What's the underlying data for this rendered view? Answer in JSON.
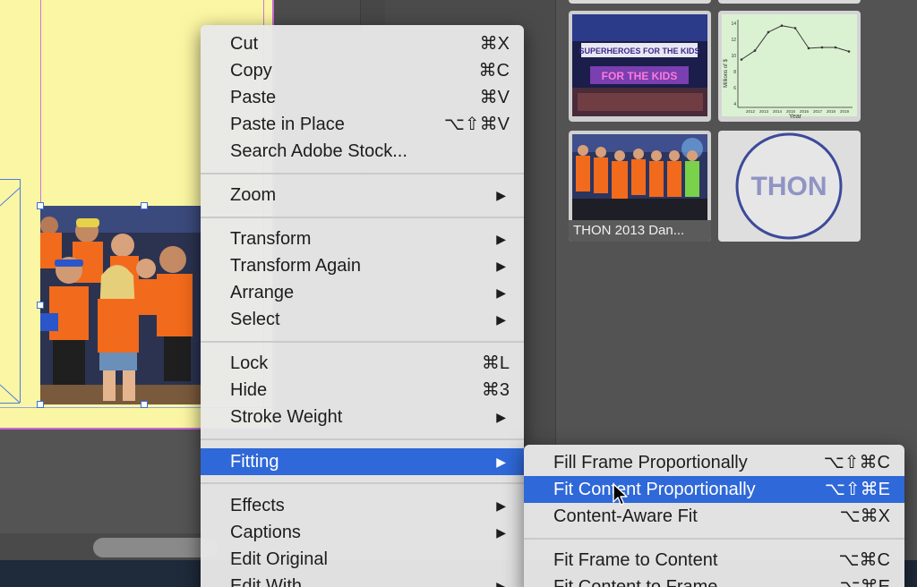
{
  "context_menu": {
    "items": [
      {
        "label": "Cut",
        "shortcut": "⌘X"
      },
      {
        "label": "Copy",
        "shortcut": "⌘C"
      },
      {
        "label": "Paste",
        "shortcut": "⌘V"
      },
      {
        "label": "Paste in Place",
        "shortcut": "⌥⇧⌘V"
      },
      {
        "label": "Search Adobe Stock...",
        "shortcut": ""
      },
      {
        "label": "Zoom",
        "submenu": true
      },
      {
        "label": "Transform",
        "submenu": true
      },
      {
        "label": "Transform Again",
        "submenu": true
      },
      {
        "label": "Arrange",
        "submenu": true
      },
      {
        "label": "Select",
        "submenu": true
      },
      {
        "label": "Lock",
        "shortcut": "⌘L"
      },
      {
        "label": "Hide",
        "shortcut": "⌘3"
      },
      {
        "label": "Stroke Weight",
        "submenu": true
      },
      {
        "label": "Fitting",
        "submenu": true,
        "active": true
      },
      {
        "label": "Effects",
        "submenu": true
      },
      {
        "label": "Captions",
        "submenu": true
      },
      {
        "label": "Edit Original",
        "shortcut": ""
      },
      {
        "label": "Edit With",
        "submenu": true
      }
    ],
    "submenu_arrow": "▶"
  },
  "fitting_submenu": {
    "items": [
      {
        "label": "Fill Frame Proportionally",
        "shortcut": "⌥⇧⌘C"
      },
      {
        "label": "Fit Content Proportionally",
        "shortcut": "⌥⇧⌘E",
        "active": true
      },
      {
        "label": "Content-Aware Fit",
        "shortcut": "⌥⌘X"
      },
      {
        "label": "Fit Frame to Content",
        "shortcut": "⌥⌘C"
      },
      {
        "label": "Fit Content to Frame",
        "shortcut": "⌥⌘E"
      }
    ]
  },
  "panel": {
    "thumb_dance_caption": "THON 2013 Dan...",
    "thon_logo_text": "THON",
    "stage_sign_text": "FOR THE KIDS",
    "stage_letters": "SUPERHEROES FOR THE KIDS",
    "chart_ylabel": "Millions of $",
    "chart_xlabel": "Year",
    "chart_ticks_y": [
      "14",
      "12",
      "10",
      "8",
      "6",
      "4"
    ],
    "chart_ticks_x": [
      "2012",
      "2013",
      "2014",
      "2015",
      "2016",
      "2017",
      "2018",
      "2019"
    ],
    "chart_values": [
      9.5,
      10.6,
      12.9,
      13.7,
      13.4,
      10.9,
      11.0,
      11.0,
      10.5
    ]
  },
  "colors": {
    "menu_highlight": "#2f68d8",
    "page_yellow": "#fbf6a3",
    "frame_blue": "#3a6fd8",
    "shirt_orange": "#f26a1b"
  }
}
